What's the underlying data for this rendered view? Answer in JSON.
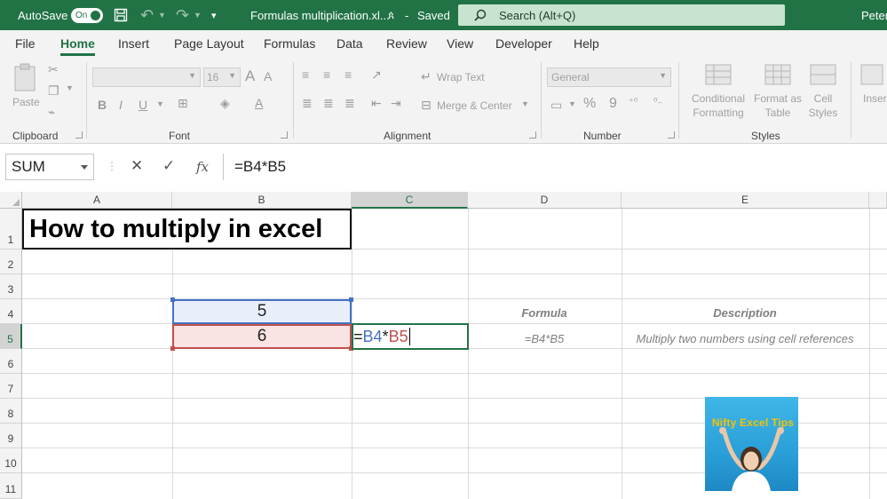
{
  "titlebar": {
    "autosave_label": "AutoSave",
    "autosave_state": "On",
    "document_title": "Formulas multiplication.xl...",
    "save_status": "Saved",
    "search_placeholder": "Search (Alt+Q)",
    "user_name": "Peter",
    "bg_color": "#217346"
  },
  "tabs": [
    "File",
    "Home",
    "Insert",
    "Page Layout",
    "Formulas",
    "Data",
    "Review",
    "View",
    "Developer",
    "Help"
  ],
  "active_tab": "Home",
  "ribbon": {
    "clipboard": {
      "label": "Clipboard",
      "paste": "Paste"
    },
    "font": {
      "label": "Font",
      "size": "16",
      "bold": "B",
      "italic": "I",
      "underline": "U"
    },
    "alignment": {
      "label": "Alignment",
      "wrap": "Wrap Text",
      "merge": "Merge & Center"
    },
    "number": {
      "label": "Number",
      "format": "General",
      "percent": "%",
      "comma": "9"
    },
    "styles": {
      "label": "Styles",
      "conditional_1": "Conditional",
      "conditional_2": "Formatting",
      "format_table_1": "Format as",
      "format_table_2": "Table",
      "cell_styles_1": "Cell",
      "cell_styles_2": "Styles"
    },
    "cells": {
      "insert": "Insert"
    }
  },
  "formula_bar": {
    "name_box": "SUM",
    "fx": "fx",
    "formula": "=B4*B5"
  },
  "columns": [
    "A",
    "B",
    "C",
    "D",
    "E"
  ],
  "rows": [
    "1",
    "2",
    "3",
    "4",
    "5",
    "6",
    "7",
    "8",
    "9",
    "10",
    "11"
  ],
  "cells": {
    "A1": "How to multiply in excel",
    "B4": "5",
    "B5": "6",
    "C5_eq": "=",
    "C5_ref1": "B4",
    "C5_op": "*",
    "C5_ref2": "B5",
    "D4": "Formula",
    "E4": "Description",
    "D5": "=B4*B5",
    "E5": "Multiply two numbers using cell references"
  },
  "logo": {
    "text": "Nifty Excel Tips"
  },
  "colors": {
    "accent": "#217346",
    "ref1": "#4472c4",
    "ref2": "#c0504d"
  }
}
